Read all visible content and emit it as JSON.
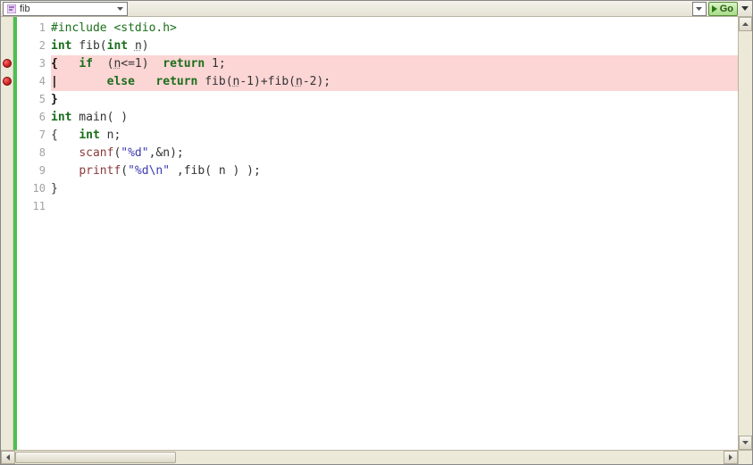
{
  "toolbar": {
    "function_dropdown_label": "fib",
    "go_button_label": "Go"
  },
  "breakpoints": [
    3,
    4
  ],
  "highlighted_lines": [
    3,
    4
  ],
  "code": {
    "lines": [
      {
        "n": 1,
        "tokens": [
          {
            "t": "#include <stdio.h>",
            "c": "pp"
          }
        ]
      },
      {
        "n": 2,
        "tokens": [
          {
            "t": "int",
            "c": "kw"
          },
          {
            "t": " fib(",
            "c": "txt"
          },
          {
            "t": "int",
            "c": "kw"
          },
          {
            "t": " ",
            "c": "txt"
          },
          {
            "t": "n",
            "c": "txt ul"
          },
          {
            "t": ")",
            "c": "txt"
          }
        ]
      },
      {
        "n": 3,
        "tokens": [
          {
            "t": "{",
            "c": "bold"
          },
          {
            "t": "   ",
            "c": "txt"
          },
          {
            "t": "if",
            "c": "kw"
          },
          {
            "t": "  (",
            "c": "txt"
          },
          {
            "t": "n",
            "c": "txt ul"
          },
          {
            "t": "<=1)  ",
            "c": "txt"
          },
          {
            "t": "return",
            "c": "kw"
          },
          {
            "t": " 1;",
            "c": "txt"
          }
        ]
      },
      {
        "n": 4,
        "tokens": [
          {
            "t": "|",
            "c": "bold"
          },
          {
            "t": "       ",
            "c": "txt"
          },
          {
            "t": "else",
            "c": "kw"
          },
          {
            "t": "   ",
            "c": "txt"
          },
          {
            "t": "return",
            "c": "kw"
          },
          {
            "t": " fib(",
            "c": "txt"
          },
          {
            "t": "n",
            "c": "txt ul"
          },
          {
            "t": "-1)+fib(",
            "c": "txt"
          },
          {
            "t": "n",
            "c": "txt ul"
          },
          {
            "t": "-2);",
            "c": "txt"
          }
        ]
      },
      {
        "n": 5,
        "tokens": [
          {
            "t": "}",
            "c": "bold"
          }
        ]
      },
      {
        "n": 6,
        "tokens": [
          {
            "t": "int",
            "c": "kw"
          },
          {
            "t": " main( )",
            "c": "txt"
          }
        ]
      },
      {
        "n": 7,
        "tokens": [
          {
            "t": "{   ",
            "c": "txt"
          },
          {
            "t": "int",
            "c": "kw"
          },
          {
            "t": " n;",
            "c": "txt"
          }
        ]
      },
      {
        "n": 8,
        "tokens": [
          {
            "t": "    ",
            "c": "txt"
          },
          {
            "t": "scanf",
            "c": "fn"
          },
          {
            "t": "(",
            "c": "txt"
          },
          {
            "t": "\"%d\"",
            "c": "str"
          },
          {
            "t": ",&n);",
            "c": "txt"
          }
        ]
      },
      {
        "n": 9,
        "tokens": [
          {
            "t": "    ",
            "c": "txt"
          },
          {
            "t": "printf",
            "c": "fn"
          },
          {
            "t": "(",
            "c": "txt"
          },
          {
            "t": "\"%d\\n\"",
            "c": "str"
          },
          {
            "t": " ,fib( n ) );",
            "c": "txt"
          }
        ]
      },
      {
        "n": 10,
        "tokens": [
          {
            "t": "}",
            "c": "txt"
          }
        ]
      },
      {
        "n": 11,
        "tokens": []
      }
    ]
  }
}
